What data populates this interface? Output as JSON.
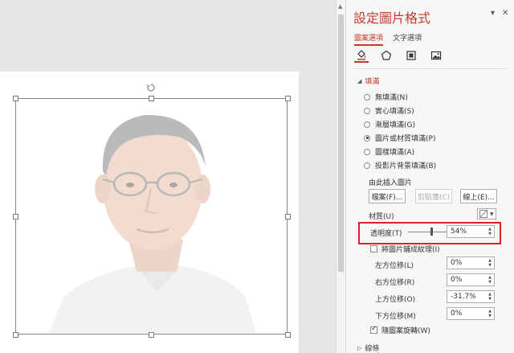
{
  "pane": {
    "title": "設定圖片格式",
    "tabs": [
      {
        "label": "圖案選項",
        "active": true
      },
      {
        "label": "文字選項",
        "active": false
      }
    ],
    "categories": [
      "fill-line-icon",
      "effects-pentagon-icon",
      "size-properties-icon",
      "picture-icon"
    ]
  },
  "fill": {
    "section_label": "填滿",
    "options": [
      {
        "label": "無填滿(N)",
        "selected": false
      },
      {
        "label": "實心填滿(S)",
        "selected": false
      },
      {
        "label": "漸層填滿(G)",
        "selected": false
      },
      {
        "label": "圖片或材質填滿(P)",
        "selected": true
      },
      {
        "label": "圖樣填滿(A)",
        "selected": false
      },
      {
        "label": "投影片背景填滿(B)",
        "selected": false
      }
    ],
    "insert_from": "由此插入圖片",
    "buttons": {
      "file": "檔案(F)...",
      "clipboard": "剪貼簿(C)",
      "online": "線上(E)..."
    },
    "texture_label": "材質(U)",
    "transparency_label": "透明度(T)",
    "transparency_value": "54%",
    "tile_label": "將圖片鋪成紋理(I)",
    "offsets": [
      {
        "label": "左方位移(L)",
        "value": "0%"
      },
      {
        "label": "右方位移(R)",
        "value": "0%"
      },
      {
        "label": "上方位移(O)",
        "value": "-31.7%"
      },
      {
        "label": "下方位移(M)",
        "value": "0%"
      }
    ],
    "rotate_label": "隨圖案旋轉(W)"
  },
  "line": {
    "section_label": "線條"
  },
  "colors": {
    "accent": "#c43c2a",
    "highlight": "#e02020"
  }
}
